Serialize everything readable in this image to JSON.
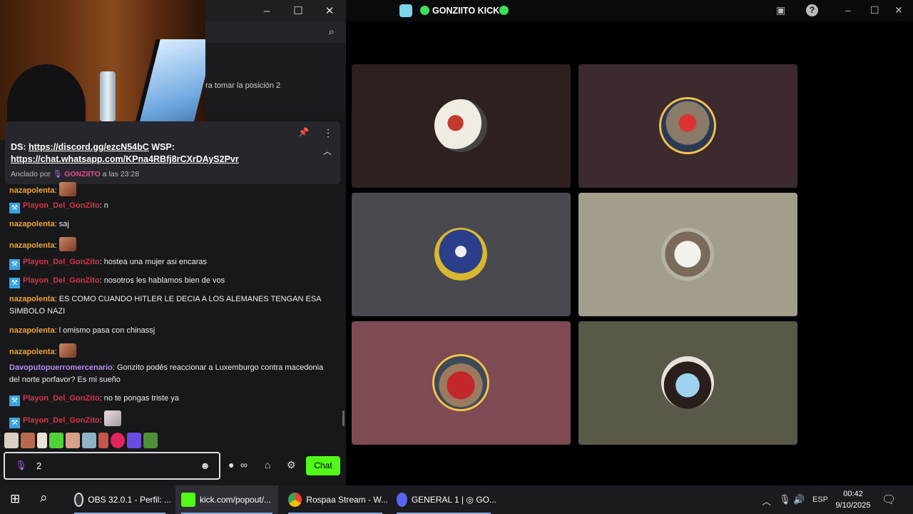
{
  "chat_window": {
    "minimize": "–",
    "maximize": "☐",
    "close": "✕",
    "search_icon": "⌕",
    "subscription_notice": "ra tomar la posición 2"
  },
  "pinned": {
    "line1_prefix": "DS: ",
    "discord_link": "https://discord.gg/ezcN54bC",
    "line1_suffix": " WSP:",
    "whatsapp_link": "https://chat.whatsapp.com/KPna4RBfj8rCXrDAyS2Pvr",
    "pinned_by_label": "Anclado por",
    "pinned_by_user": "GONZIITO",
    "pinned_time": "a las 23:28"
  },
  "messages": [
    {
      "user": "nazapolenta",
      "sep": ":",
      "text": ""
    },
    {
      "user": "Playon_Del_GonZito",
      "sep": ":",
      "text": " n"
    },
    {
      "user": "nazapolenta",
      "sep": ":",
      "text": " saj"
    },
    {
      "user": "nazapolenta",
      "sep": ":",
      "text": ""
    },
    {
      "user": "Playon_Del_GonZito",
      "sep": ":",
      "text": " hostea una mujer asi encaras"
    },
    {
      "user": "Playon_Del_GonZito",
      "sep": ":",
      "text": " nosotros les hablamos bien de vos"
    },
    {
      "user": "nazapolenta",
      "sep": ":",
      "text": " ES COMO CUANDO HITLER LE DECIA A LOS ALEMANES TENGAN ESA SIMBOLO NAZI"
    },
    {
      "user": "nazapolenta",
      "sep": ":",
      "text": " l omismo pasa con chinassj"
    },
    {
      "user": "nazapolenta",
      "sep": ":",
      "text": ""
    },
    {
      "user": "Davoputopuerromercenario",
      "sep": ":",
      "text": " Gonzito podés reaccionar a Luxemburgo contra macedonia del norte porfavor? Es mi sueño"
    },
    {
      "user": "Playon_Del_GonZito",
      "sep": ":",
      "text": " no te pongas triste ya"
    },
    {
      "user": "Playon_Del_GonZito",
      "sep": ":",
      "text": ""
    }
  ],
  "input": {
    "value": "2",
    "send_label": "Chat"
  },
  "call": {
    "channel_name": "GONZIITO KICK",
    "help_icon": "?",
    "minimize": "–",
    "maximize": "☐",
    "close": "✕"
  },
  "taskbar": {
    "items": [
      {
        "label": "OBS 32.0.1 - Perfil: ..."
      },
      {
        "label": "kick.com/popout/..."
      },
      {
        "label": "Rospaa Stream - W..."
      },
      {
        "label": "GENERAL 1 | ◎ GO..."
      }
    ],
    "language": "ESP",
    "time": "00:42",
    "date": "9/10/2025"
  },
  "colors": {
    "kick_green": "#53fc18",
    "chat_bg": "#18181b",
    "username_orange": "#f2a32b",
    "username_red": "#d6344a",
    "username_purple": "#b48cf2",
    "online_green": "#3ce05a"
  }
}
